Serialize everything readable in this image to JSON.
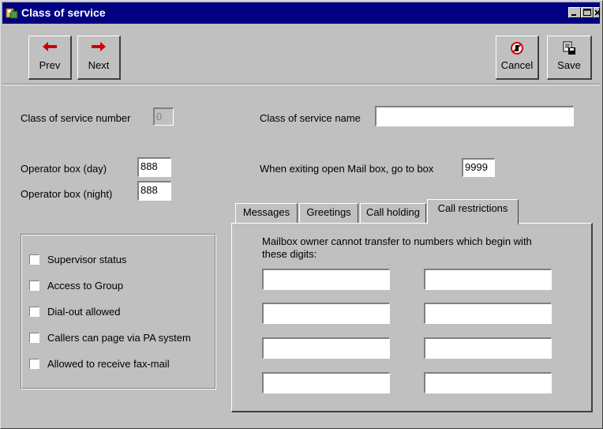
{
  "window": {
    "title": "Class of service",
    "controls": {
      "minimize": "_",
      "maximize": "□",
      "close": "×"
    }
  },
  "toolbar": {
    "prev_label": "Prev",
    "next_label": "Next",
    "cancel_label": "Cancel",
    "save_label": "Save"
  },
  "form": {
    "cos_number_label": "Class of service number",
    "cos_number_value": "0",
    "cos_name_label": "Class of service name",
    "cos_name_value": "",
    "operator_day_label": "Operator box (day)",
    "operator_day_value": "888",
    "operator_night_label": "Operator box (night)",
    "operator_night_value": "888",
    "exit_box_label": "When exiting open Mail box, go to box",
    "exit_box_value": "9999"
  },
  "options": [
    {
      "label": "Supervisor status",
      "checked": false
    },
    {
      "label": "Access to Group",
      "checked": false
    },
    {
      "label": "Dial-out allowed",
      "checked": false
    },
    {
      "label": "Callers can page via PA system",
      "checked": false
    },
    {
      "label": "Allowed to receive fax-mail",
      "checked": false
    }
  ],
  "tabs": [
    {
      "label": "Messages"
    },
    {
      "label": "Greetings"
    },
    {
      "label": "Call holding"
    },
    {
      "label": "Call restrictions",
      "active": true
    }
  ],
  "restrictions": {
    "instruction_line1": "Mailbox owner cannot transfer to numbers which begin with",
    "instruction_line2": "these digits:",
    "digits": [
      "",
      "",
      "",
      "",
      "",
      "",
      "",
      ""
    ]
  },
  "colors": {
    "titlebar": "#000080",
    "face": "#c0c0c0",
    "arrow": "#cc0000"
  }
}
